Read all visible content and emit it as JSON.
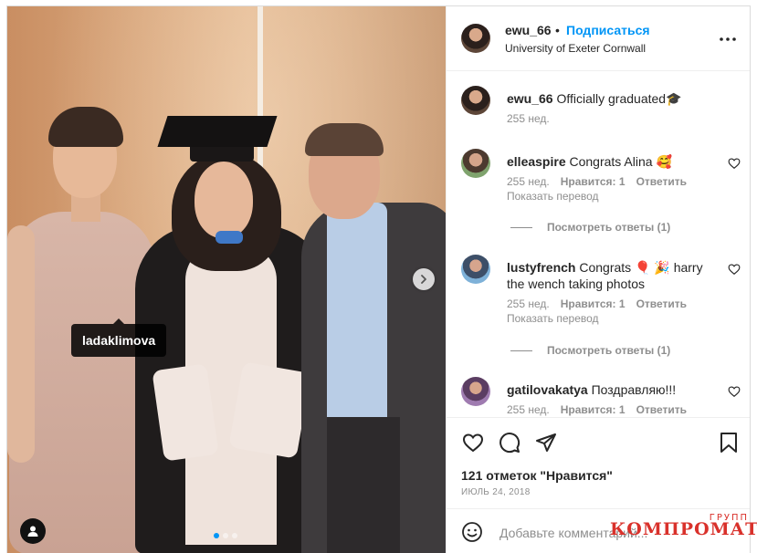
{
  "post": {
    "username": "ewu_66",
    "separator": "•",
    "follow_label": "Подписаться",
    "location": "University of Exeter Cornwall"
  },
  "photo": {
    "tag_label": "ladaklimova",
    "carousel_count": 3,
    "carousel_active": 1
  },
  "comments": [
    {
      "user": "ewu_66",
      "text": "Officially graduated🎓",
      "time": "255 нед."
    },
    {
      "user": "elleaspire",
      "text": "Congrats Alina 🥰",
      "time": "255 нед.",
      "likes": "Нравится: 1",
      "reply": "Ответить",
      "translate": "Показать перевод",
      "view_replies": "Посмотреть ответы (1)"
    },
    {
      "user": "lustyfrench",
      "text": "Congrats 🎈 🎉 harry the wench taking photos",
      "time": "255 нед.",
      "likes": "Нравится: 1",
      "reply": "Ответить",
      "translate": "Показать перевод",
      "view_replies": "Посмотреть ответы (1)"
    },
    {
      "user": "gatilovakatya",
      "text": "Поздравляю!!!",
      "time": "255 нед.",
      "likes": "Нравится: 1",
      "reply": "Ответить"
    }
  ],
  "actions": {
    "likes_text": "121 отметок \"Нравится\"",
    "date": "ИЮЛЬ 24, 2018"
  },
  "add_comment": {
    "placeholder": "Добавьте комментарий..."
  },
  "watermark": {
    "top": "ГРУПП",
    "main": "КОМПРОМАТ"
  },
  "colors": {
    "accent": "#0095f6",
    "meta_gray": "#8e8e8e",
    "watermark_red": "#d9312b"
  }
}
